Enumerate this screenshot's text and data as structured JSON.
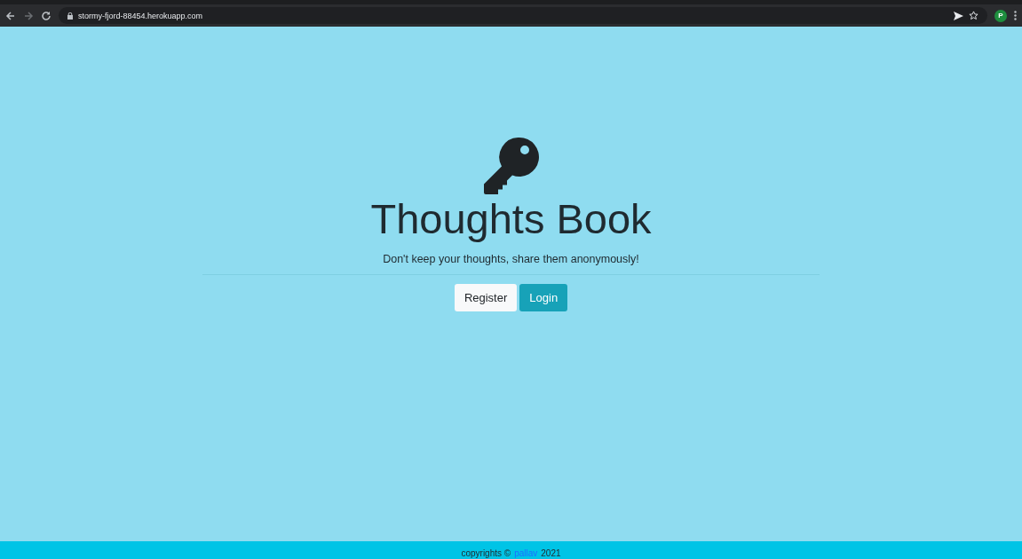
{
  "browser": {
    "url": "stormy-fjord-88454.herokuapp.com",
    "profile_initial": "P"
  },
  "hero": {
    "title": "Thoughts Book",
    "tagline": "Don't keep your thoughts, share them anonymously!"
  },
  "buttons": [
    {
      "label": "Register",
      "kind": "light"
    },
    {
      "label": "Login",
      "kind": "primary"
    }
  ],
  "footer": {
    "prefix": "copyrights ©",
    "author": "pallav",
    "year": "2021"
  }
}
